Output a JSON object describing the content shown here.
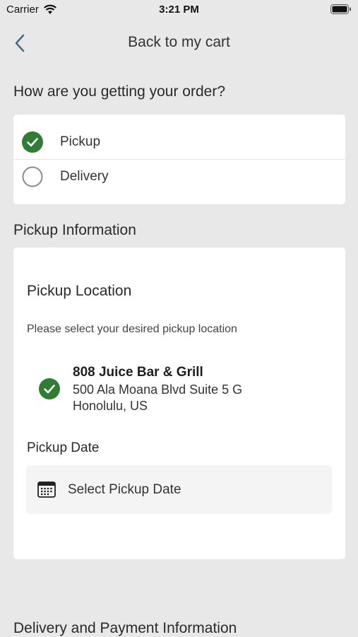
{
  "status_bar": {
    "carrier": "Carrier",
    "time": "3:21 PM"
  },
  "nav": {
    "back_label": "Back to my cart"
  },
  "order_method": {
    "question": "How are you getting your order?",
    "options": [
      {
        "label": "Pickup",
        "selected": true
      },
      {
        "label": "Delivery",
        "selected": false
      }
    ]
  },
  "pickup_info": {
    "heading": "Pickup Information",
    "location_title": "Pickup Location",
    "location_desc": "Please select your desired pickup location",
    "location": {
      "name": "808 Juice Bar & Grill",
      "address_line1": "500 Ala Moana Blvd Suite 5 G",
      "address_line2": "Honolulu, US",
      "selected": true
    },
    "date_label": "Pickup Date",
    "date_placeholder": "Select Pickup Date"
  },
  "delivery_payment": {
    "heading": "Delivery and Payment Information"
  },
  "colors": {
    "accent": "#2e7d32",
    "background": "#e8e8e8",
    "card": "#ffffff"
  },
  "icons": [
    "wifi-icon",
    "battery-icon",
    "chevron-left-icon",
    "check-circle-icon",
    "radio-empty-icon",
    "calendar-icon"
  ]
}
